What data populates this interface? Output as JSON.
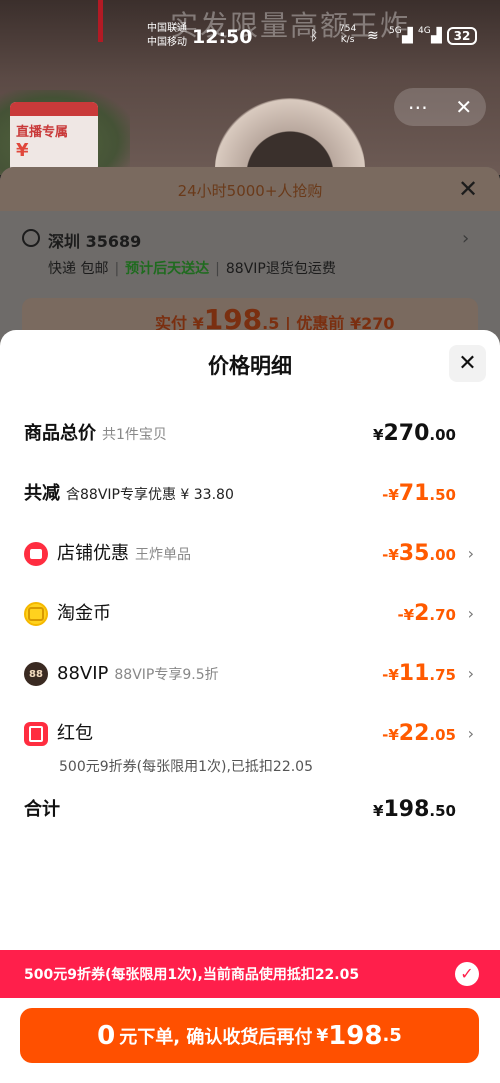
{
  "status_bar": {
    "carrier_1": "中国联通",
    "carrier_2": "中国移动",
    "time": "12:50",
    "net_speed_value": "754",
    "net_speed_unit": "K/s",
    "signal_1": "5G",
    "signal_2": "4G",
    "battery": "32"
  },
  "background": {
    "headline": "实发限量高额王炸",
    "live_badge": "直播专属",
    "promo_strip": "24小时5000+人抢购",
    "address_city": "深圳 35689",
    "shipping_express": "快递 包邮",
    "shipping_eta": "预计后天送达",
    "shipping_vip": "88VIP退货包运费",
    "pay_prefix": "实付 ¥",
    "pay_int": "198",
    "pay_dec": ".5",
    "pay_before": "| 优惠前 ¥270"
  },
  "sheet": {
    "title": "价格明细",
    "rows": {
      "total": {
        "label": "商品总价",
        "sub": "共1件宝贝",
        "sym": "¥",
        "int": "270",
        "dec": ".00"
      },
      "reduce": {
        "label": "共减",
        "sub": "含88VIP专享优惠 ¥ 33.80",
        "sym": "-¥",
        "int": "71",
        "dec": ".50"
      },
      "store": {
        "label": "店铺优惠",
        "sub": "王炸单品",
        "sym": "-¥",
        "int": "35",
        "dec": ".00",
        "icon": "store-icon"
      },
      "coin": {
        "label": "淘金币",
        "sub": "",
        "sym": "-¥",
        "int": "2",
        "dec": ".70",
        "icon": "coin-icon"
      },
      "vip": {
        "label": "88VIP",
        "sub": "88VIP专享9.5折",
        "sym": "-¥",
        "int": "11",
        "dec": ".75",
        "icon_text": "88"
      },
      "hongbao": {
        "label": "红包",
        "sym": "-¥",
        "int": "22",
        "dec": ".05",
        "note": "500元9折券(每张限用1次),已抵扣22.05",
        "icon": "red-packet-icon"
      },
      "sum": {
        "label": "合计",
        "sym": "¥",
        "int": "198",
        "dec": ".50"
      }
    }
  },
  "bottom": {
    "coupon_text": "500元9折券(每张限用1次),当前商品使用抵扣22.05",
    "cta_zero": "0",
    "cta_text": "元下单, 确认收货后再付",
    "cta_sym": "¥",
    "cta_int": "198",
    "cta_dec": ".5"
  },
  "colors": {
    "accent_orange": "#ff5000",
    "coupon_red": "#ff1f4b",
    "discount_orange": "#ff5a00"
  }
}
